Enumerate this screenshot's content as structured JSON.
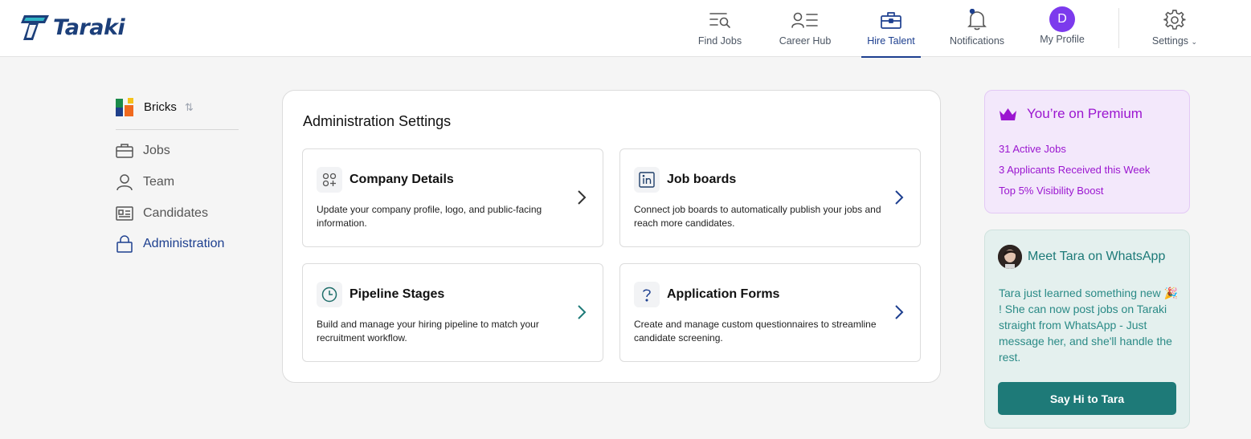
{
  "app": {
    "logo_text": "Taraki"
  },
  "nav": {
    "find_jobs": "Find Jobs",
    "career_hub": "Career Hub",
    "hire_talent": "Hire Talent",
    "notifications": "Notifications",
    "my_profile": "My Profile",
    "profile_initial": "D",
    "settings": "Settings"
  },
  "sidebar": {
    "org_name": "Bricks",
    "org_sort_glyph": "⇅",
    "items": [
      {
        "label": "Jobs",
        "icon": "briefcase-icon"
      },
      {
        "label": "Team",
        "icon": "user-icon"
      },
      {
        "label": "Candidates",
        "icon": "id-card-icon"
      },
      {
        "label": "Administration",
        "icon": "lock-icon",
        "active": true
      }
    ]
  },
  "main": {
    "title": "Administration Settings",
    "cards": [
      {
        "title": "Company Details",
        "description": "Update your company profile, logo, and public-facing information.",
        "icon": "grid-plus-icon"
      },
      {
        "title": "Job boards",
        "description": "Connect job boards to automatically publish your jobs and reach more candidates.",
        "icon": "linkedin-icon"
      },
      {
        "title": "Pipeline Stages",
        "description": "Build and manage your hiring pipeline to match your recruitment workflow.",
        "icon": "clock-icon"
      },
      {
        "title": "Application Forms",
        "description": "Create and manage custom questionnaires to streamline candidate screening.",
        "icon": "question-icon"
      }
    ]
  },
  "premium": {
    "title": "You’re on Premium",
    "lines": [
      "31 Active Jobs",
      "3 Applicants Received this Week",
      "Top 5% Visibility Boost"
    ]
  },
  "whatsapp": {
    "title": "Meet Tara on WhatsApp",
    "body": "Tara just learned something new 🎉 ! She can now post jobs on Taraki straight from WhatsApp - Just message her, and she'll handle the rest.",
    "button": "Say Hi to Tara"
  },
  "colors": {
    "brand": "#1d3f8f",
    "premium": "#9b16d0",
    "whatsapp": "#1e7a78",
    "avatar": "#7c3aed"
  }
}
